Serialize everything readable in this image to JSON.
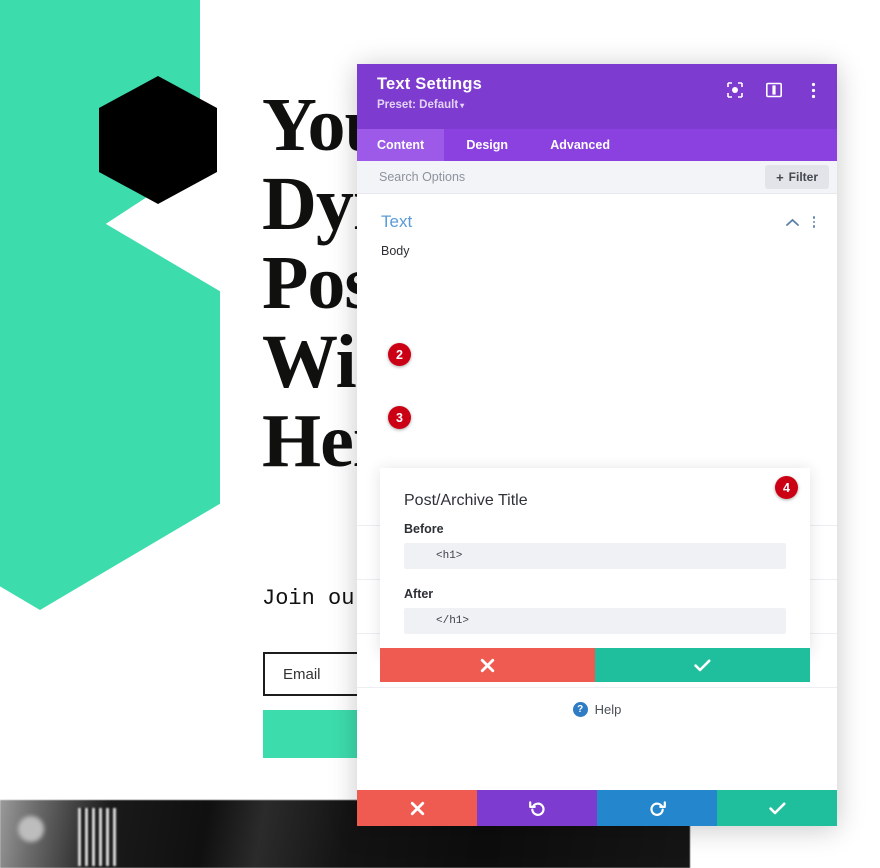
{
  "background_page": {
    "headline": "You\nDyr\nPos\nWi\nHei",
    "join_text": "Join ou",
    "email_placeholder": "Email",
    "colors": {
      "teal": "#3ddcad",
      "black": "#000000"
    }
  },
  "modal": {
    "title": "Text Settings",
    "preset": "Preset: Default",
    "preset_caret": "▾",
    "header_icons": [
      {
        "name": "focus-icon"
      },
      {
        "name": "layout-columns-icon"
      },
      {
        "name": "kebab-menu-icon"
      }
    ],
    "tabs": [
      {
        "label": "Content",
        "active": true
      },
      {
        "label": "Design",
        "active": false
      },
      {
        "label": "Advanced",
        "active": false
      }
    ],
    "search": {
      "placeholder": "Search Options",
      "value": ""
    },
    "filter_button": {
      "plus": "+",
      "label": "Filter"
    },
    "section": {
      "title": "Text",
      "collapse_icon": "⌃",
      "field_label": "Body"
    },
    "dynamic_panel": {
      "title": "Post/Archive Title",
      "before_label": "Before",
      "before_value": "<h1>",
      "after_label": "After",
      "after_value": "</h1>",
      "cancel_icon": "✖",
      "confirm_icon": "✔"
    },
    "help": {
      "icon": "?",
      "label": "Help"
    },
    "footer_buttons": [
      {
        "name": "cancel",
        "icon": "✖",
        "color": "#ef5a51"
      },
      {
        "name": "undo",
        "icon": "↺",
        "color": "#7e3bd0"
      },
      {
        "name": "redo",
        "icon": "↻",
        "color": "#2486cd"
      },
      {
        "name": "save",
        "icon": "✔",
        "color": "#1fbf9e"
      }
    ],
    "colors": {
      "header": "#7e3bd0",
      "tabbar": "#8b41e0",
      "tab_active": "#9d5ae8",
      "section_title": "#5a9bd6",
      "red": "#ef5a51",
      "green": "#1fbf9e",
      "blue": "#2486cd"
    }
  },
  "annotations": [
    {
      "number": "2",
      "target": "before-input"
    },
    {
      "number": "3",
      "target": "after-input"
    },
    {
      "number": "4",
      "target": "dynamic-confirm-button"
    }
  ]
}
